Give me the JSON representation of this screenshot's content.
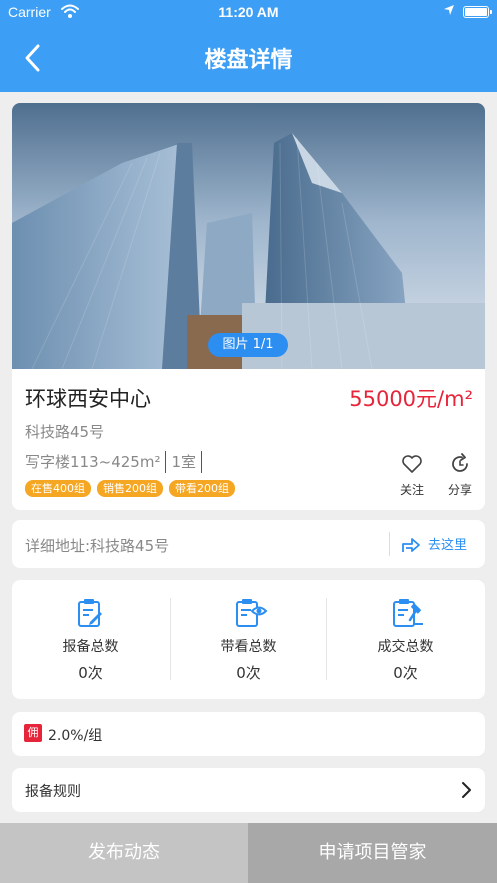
{
  "status_bar": {
    "carrier": "Carrier",
    "time": "11:20 AM"
  },
  "header": {
    "title": "楼盘详情"
  },
  "gallery": {
    "badge": "图片 1/1"
  },
  "property": {
    "name": "环球西安中心",
    "price": "55000元/m²",
    "address": "科技路45号",
    "meta": [
      "写字楼113~425m²",
      "1室"
    ],
    "tags": [
      "在售400组",
      "销售200组",
      "带看200组"
    ]
  },
  "actions": {
    "follow": "关注",
    "share": "分享"
  },
  "location": {
    "detail": "详细地址:科技路45号",
    "go": "去这里"
  },
  "stats": [
    {
      "label": "报备总数",
      "value": "0次"
    },
    {
      "label": "带看总数",
      "value": "0次"
    },
    {
      "label": "成交总数",
      "value": "0次"
    }
  ],
  "commission": {
    "badge": "佣",
    "text": "2.0%/组"
  },
  "rules": {
    "label": "报备规则"
  },
  "footer": {
    "publish": "发布动态",
    "apply": "申请项目管家"
  },
  "colors": {
    "primary": "#3c9ef4",
    "accent_blue": "#2b8ef0",
    "price_red": "#e6243a",
    "tag_orange": "#f5a623"
  }
}
